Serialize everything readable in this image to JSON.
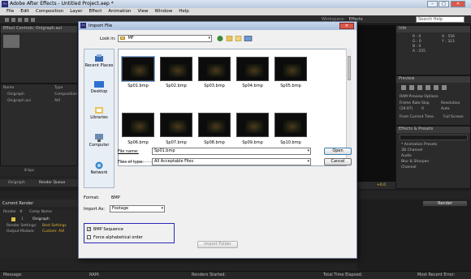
{
  "app": {
    "title": "Adobe After Effects - Untitled Project.aep *",
    "logo_text": "Ae",
    "window_buttons": [
      "–",
      "□",
      "✕"
    ],
    "menu": [
      "File",
      "Edit",
      "Composition",
      "Layer",
      "Effect",
      "Animation",
      "View",
      "Window",
      "Help"
    ],
    "workspace_label": "Workspace:",
    "workspace_value": "Effects",
    "search_help": "Search Help"
  },
  "left_panels": {
    "effect_controls_tab": "Effect Controls: Onigraph.avi",
    "project_columns": [
      "Name",
      "Type"
    ],
    "project_items": [
      {
        "name": "Onigraph",
        "type": "Composition"
      },
      {
        "name": "Onigraph.avi",
        "type": "AVI"
      }
    ],
    "bpc": "8 bpc",
    "timeline_tabs": [
      "Onigraph",
      "Render Queue"
    ]
  },
  "render_queue": {
    "header": "Current Render",
    "columns": [
      "Render",
      "#",
      "Comp Name"
    ],
    "row_num": "1",
    "comp_name": "Onigraph",
    "render_settings_label": "Render Settings:",
    "render_settings_value": "Best Settings",
    "output_module_label": "Output Module:",
    "output_module_value": "Custom: AVI",
    "render_button": "Render"
  },
  "info_panel": {
    "tab": "Info",
    "r": "R : 0",
    "g": "G : 0",
    "b": "B : 0",
    "a": "A : 255",
    "x": "X : 556",
    "y": "Y : 323"
  },
  "preview_panel": {
    "tab": "Preview",
    "ram_options": "RAM Preview Options",
    "frame_rate_label": "Frame Rate",
    "skip_label": "Skip",
    "resolution_label": "Resolution",
    "frame_rate_value": "(29.97)",
    "skip_value": "0",
    "resolution_value": "Auto",
    "from_current": "From Current Time",
    "full_screen": "Full Screen"
  },
  "effects_panel": {
    "tab": "Effects & Presets",
    "items": [
      "* Animation Presets",
      "3D Channel",
      "Audio",
      "Blur & Sharpen",
      "Channel"
    ]
  },
  "dialog": {
    "title": "Import File",
    "look_in_label": "Look in:",
    "look_in_value": "MF",
    "places": [
      "Recent Places",
      "Desktop",
      "Libraries",
      "Computer",
      "Network"
    ],
    "files": [
      "Sp01.bmp",
      "Sp02.bmp",
      "Sp03.bmp",
      "Sp04.bmp",
      "Sp05.bmp",
      "Sp06.bmp",
      "Sp07.bmp",
      "Sp08.bmp",
      "Sp09.bmp",
      "Sp10.bmp"
    ],
    "file_name_label": "File name:",
    "file_name_value": "Sp01.bmp",
    "files_of_type_label": "Files of type:",
    "files_of_type_value": "All Acceptable Files",
    "open_button": "Open",
    "cancel_button": "Cancel",
    "format_label": "Format:",
    "format_value": "BMP",
    "import_as_label": "Import As:",
    "import_as_value": "Footage",
    "bmp_sequence_label": "BMP Sequence",
    "bmp_sequence_checked": true,
    "force_alpha_label": "Force alphabetical order",
    "import_folder_button": "Import Folder"
  },
  "status": {
    "message": "Message:",
    "ram": "RAM:",
    "renders_started": "Renders Started:",
    "total_elapsed": "Total Time Elapsed:",
    "recent_error": "Most Recent Error:"
  },
  "zoom_readout": "+0.0"
}
